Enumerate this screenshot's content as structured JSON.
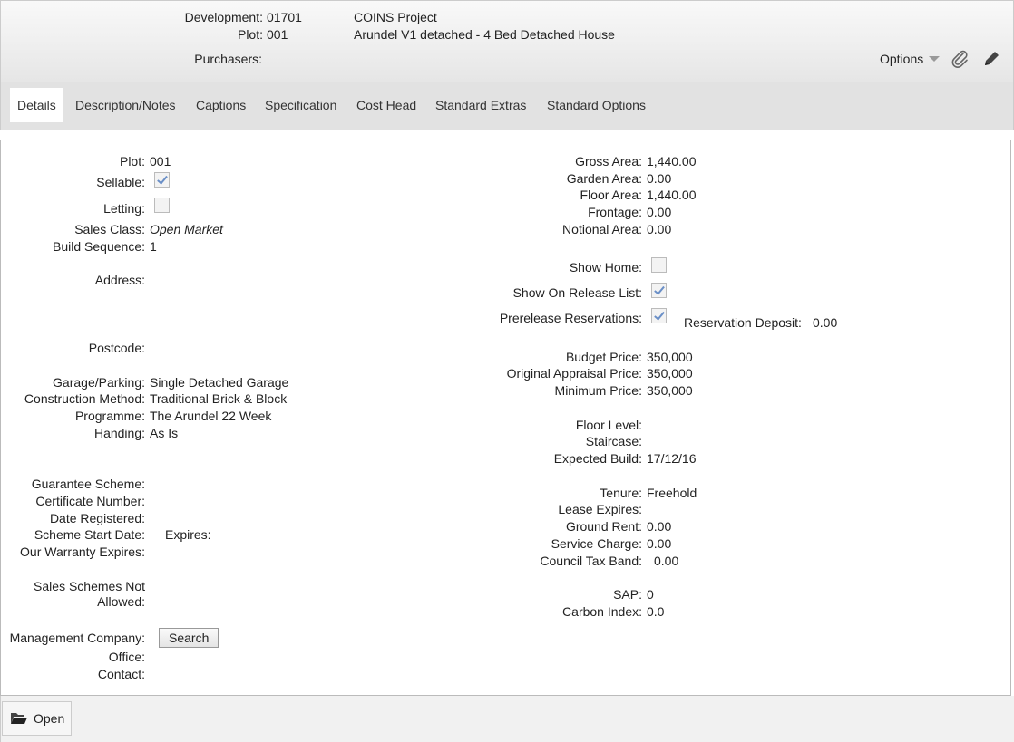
{
  "header": {
    "development_label": "Development:",
    "development_value": "01701",
    "project_name": "COINS Project",
    "plot_label": "Plot:",
    "plot_value": "001",
    "plot_description": "Arundel V1 detached - 4 Bed Detached House",
    "purchasers_label": "Purchasers:",
    "options_label": "Options",
    "attach_icon": "paperclip-icon",
    "edit_icon": "pencil-icon"
  },
  "tabs": [
    "Details",
    "Description/Notes",
    "Captions",
    "Specification",
    "Cost Head",
    "Standard Extras",
    "Standard Options"
  ],
  "left": {
    "plot_label": "Plot:",
    "plot_value": "001",
    "sellable_label": "Sellable:",
    "sellable_checked": true,
    "letting_label": "Letting:",
    "letting_checked": false,
    "sales_class_label": "Sales Class:",
    "sales_class_value": "Open Market",
    "build_sequence_label": "Build Sequence:",
    "build_sequence_value": "1",
    "address_label": "Address:",
    "postcode_label": "Postcode:",
    "garage_label": "Garage/Parking:",
    "garage_value": "Single Detached Garage",
    "construction_label": "Construction Method:",
    "construction_value": "Traditional Brick & Block",
    "programme_label": "Programme:",
    "programme_value": "The Arundel 22 Week",
    "handing_label": "Handing:",
    "handing_value": "As Is",
    "guarantee_label": "Guarantee Scheme:",
    "certificate_label": "Certificate Number:",
    "date_registered_label": "Date Registered:",
    "scheme_start_label": "Scheme Start Date:",
    "expires_label": "Expires:",
    "warranty_label": "Our Warranty Expires:",
    "sales_schemes_label_1": "Sales Schemes Not",
    "sales_schemes_label_2": "Allowed:",
    "management_label": "Management Company:",
    "search_button": "Search",
    "office_label": "Office:",
    "contact_label": "Contact:"
  },
  "right": {
    "gross_area_label": "Gross Area:",
    "gross_area_value": "1,440.00",
    "garden_area_label": "Garden Area:",
    "garden_area_value": "0.00",
    "floor_area_label": "Floor Area:",
    "floor_area_value": "1,440.00",
    "frontage_label": "Frontage:",
    "frontage_value": "0.00",
    "notional_area_label": "Notional Area:",
    "notional_area_value": "0.00",
    "show_home_label": "Show Home:",
    "show_home_checked": false,
    "show_release_label": "Show On Release List:",
    "show_release_checked": true,
    "prerelease_label": "Prerelease Reservations:",
    "prerelease_checked": true,
    "reservation_deposit_label": "Reservation Deposit:",
    "reservation_deposit_value": "0.00",
    "budget_price_label": "Budget Price:",
    "budget_price_value": "350,000",
    "original_price_label": "Original Appraisal Price:",
    "original_price_value": "350,000",
    "minimum_price_label": "Minimum Price:",
    "minimum_price_value": "350,000",
    "floor_level_label": "Floor Level:",
    "staircase_label": "Staircase:",
    "expected_build_label": "Expected Build:",
    "expected_build_value": "17/12/16",
    "tenure_label": "Tenure:",
    "tenure_value": "Freehold",
    "lease_expires_label": "Lease Expires:",
    "ground_rent_label": "Ground Rent:",
    "ground_rent_value": "0.00",
    "service_charge_label": "Service Charge:",
    "service_charge_value": "0.00",
    "council_tax_label": "Council Tax Band:",
    "council_tax_value": "0.00",
    "sap_label": "SAP:",
    "sap_value": "0",
    "carbon_label": "Carbon Index:",
    "carbon_value": "0.0"
  },
  "footer": {
    "open_label": "Open",
    "open_icon": "folder-open-icon"
  }
}
